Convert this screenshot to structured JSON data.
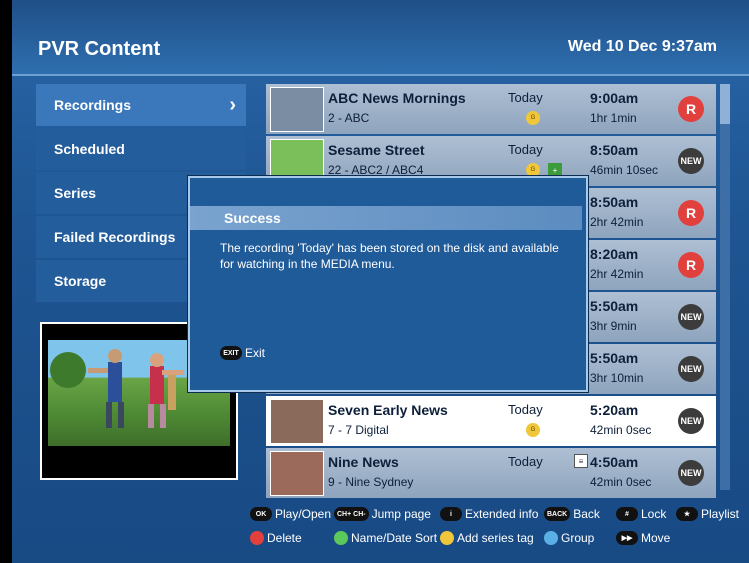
{
  "header": {
    "title": "PVR Content",
    "clock": "Wed 10 Dec 9:37am"
  },
  "sidebar": {
    "items": [
      {
        "label": "Recordings",
        "arrow": "›"
      },
      {
        "label": "Scheduled"
      },
      {
        "label": "Series"
      },
      {
        "label": "Failed Recordings"
      },
      {
        "label": "Storage"
      }
    ]
  },
  "list": {
    "rows": [
      {
        "title": "ABC News Mornings",
        "channel": "2 - ABC",
        "date": "Today",
        "time": "9:00am",
        "duration": "1hr 1min",
        "icon": "R",
        "icon_type": "recording-icon"
      },
      {
        "title": "Sesame Street",
        "channel": "22 - ABC2 / ABC4",
        "date": "Today",
        "time": "8:50am",
        "duration": "46min 10sec",
        "icon": "NEW",
        "icon_type": "new-icon"
      },
      {
        "title": "",
        "channel": "",
        "date": "",
        "time": "8:50am",
        "duration": "2hr 42min",
        "icon": "R",
        "icon_type": "recording-icon"
      },
      {
        "title": "",
        "channel": "",
        "date": "",
        "time": "8:20am",
        "duration": "2hr 42min",
        "icon": "R",
        "icon_type": "recording-icon"
      },
      {
        "title": "",
        "channel": "",
        "date": "",
        "time": "5:50am",
        "duration": "3hr 9min",
        "icon": "NEW",
        "icon_type": "new-icon"
      },
      {
        "title": "",
        "channel": "",
        "date": "",
        "time": "5:50am",
        "duration": "3hr 10min",
        "icon": "NEW",
        "icon_type": "new-icon"
      },
      {
        "title": "Seven Early News",
        "channel": "7 - 7 Digital",
        "date": "Today",
        "time": "5:20am",
        "duration": "42min 0sec",
        "icon": "NEW",
        "icon_type": "new-icon"
      },
      {
        "title": "Nine News",
        "channel": "9 - Nine Sydney",
        "date": "Today",
        "time": "4:50am",
        "duration": "42min 0sec",
        "icon": "NEW",
        "icon_type": "new-icon"
      }
    ]
  },
  "dialog": {
    "title": "Success",
    "message": "The recording 'Today' has been stored on the disk and available for watching in the MEDIA menu.",
    "exit_key": "EXIT",
    "exit_label": "Exit"
  },
  "footer": {
    "ok_key": "OK",
    "play_open": "Play/Open",
    "ch_keys": "CH+ CH-",
    "jump_page": "Jump page",
    "info_key": "i",
    "extended_info": "Extended info",
    "back_key": "BACK",
    "back": "Back",
    "lock_key": "#",
    "lock": "Lock",
    "playlist_key": "★",
    "playlist": "Playlist",
    "delete": "Delete",
    "name_date_sort": "Name/Date Sort",
    "add_series_tag": "Add series tag",
    "group": "Group",
    "move_key": "▶▶",
    "move": "Move"
  },
  "colors": {
    "red": "#e2403c",
    "green": "#5cc85c",
    "yellow": "#f0c63b",
    "blue": "#5ab0e6",
    "header": "#1f4f86",
    "selected_row": "#ffffff"
  }
}
